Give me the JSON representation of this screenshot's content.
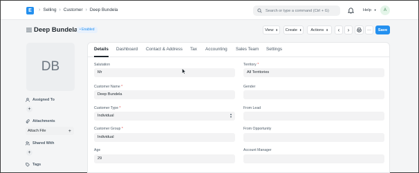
{
  "navbar": {
    "logo_letter": "E",
    "breadcrumbs": [
      "Selling",
      "Customer",
      "Deep Bundela"
    ],
    "search_placeholder": "Search or type a command (Ctrl + G)",
    "help_label": "Help",
    "user_initial": "A"
  },
  "page": {
    "title": "Deep Bundela",
    "status_badge": "Enabled",
    "buttons": {
      "view": "View",
      "create": "Create",
      "actions": "Actions",
      "save": "Save"
    }
  },
  "sidebar": {
    "image_initials": "DB",
    "assigned_to": "Assigned To",
    "attachments": "Attachments",
    "attach_file": "Attach File",
    "shared_with": "Shared With",
    "tags": "Tags"
  },
  "tabs": [
    "Details",
    "Dashboard",
    "Contact & Address",
    "Tax",
    "Accounting",
    "Sales Team",
    "Settings"
  ],
  "form": {
    "left": [
      {
        "label": "Salutation",
        "required": false,
        "value": "Mr"
      },
      {
        "label": "Customer Name",
        "required": true,
        "value": "Deep Bundela"
      },
      {
        "label": "Customer Type",
        "required": true,
        "value": "Individual"
      },
      {
        "label": "Customer Group",
        "required": true,
        "value": "Individual"
      },
      {
        "label": "Age",
        "required": false,
        "value": "29"
      }
    ],
    "right": [
      {
        "label": "Territory",
        "required": true,
        "value": "All Territories"
      },
      {
        "label": "Gender",
        "required": false,
        "value": ""
      },
      {
        "label": "From Lead",
        "required": false,
        "value": ""
      },
      {
        "label": "From Opportunity",
        "required": false,
        "value": ""
      },
      {
        "label": "Account Manager",
        "required": false,
        "value": ""
      }
    ]
  },
  "colors": {
    "primary": "#2490ef",
    "page_bg": "#f4f5f6",
    "input_bg": "#f3f3f4",
    "required": "#e24c4c"
  },
  "icons": [
    "app-logo",
    "chevron-right-icon",
    "search-icon",
    "bell-icon",
    "chevron-down-icon",
    "hamburger-icon",
    "chevron-left-icon",
    "printer-icon",
    "more-icon",
    "plus-icon",
    "user-icon",
    "paperclip-icon",
    "share-icon",
    "tag-icon"
  ]
}
